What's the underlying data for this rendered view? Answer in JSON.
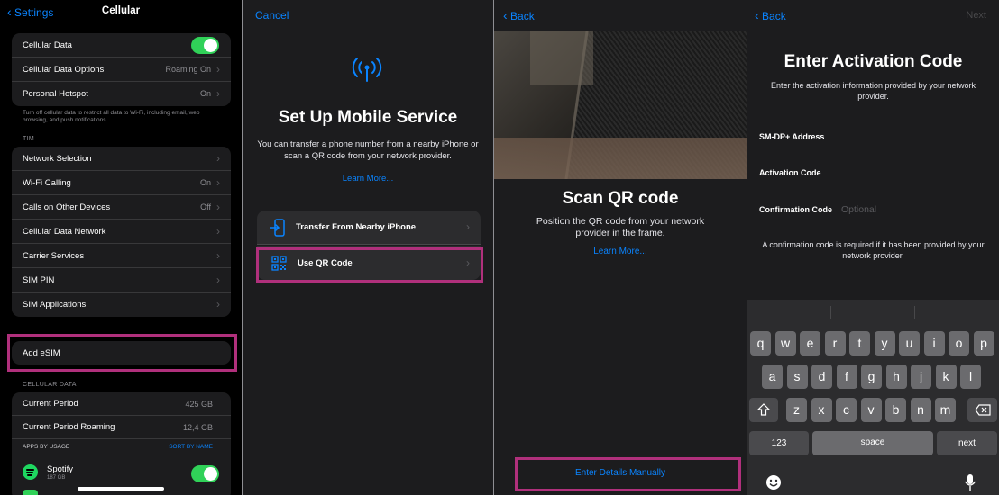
{
  "panel1": {
    "back_label": "Settings",
    "title": "Cellular",
    "top_rows": [
      {
        "label": "Cellular Data",
        "value": ""
      },
      {
        "label": "Cellular Data Options",
        "value": "Roaming On"
      },
      {
        "label": "Personal Hotspot",
        "value": "On"
      }
    ],
    "footnote": "Turn off cellular data to restrict all data to Wi-Fi, including email, web browsing, and push notifications.",
    "carrier_header": "TIM",
    "carrier_rows": [
      {
        "label": "Network Selection",
        "value": ""
      },
      {
        "label": "Wi-Fi Calling",
        "value": "On"
      },
      {
        "label": "Calls on Other Devices",
        "value": "Off"
      },
      {
        "label": "Cellular Data Network",
        "value": ""
      },
      {
        "label": "Carrier Services",
        "value": ""
      },
      {
        "label": "SIM PIN",
        "value": ""
      },
      {
        "label": "SIM Applications",
        "value": ""
      }
    ],
    "add_esim": "Add eSIM",
    "data_header": "CELLULAR DATA",
    "usage_rows": [
      {
        "label": "Current Period",
        "value": "425 GB"
      },
      {
        "label": "Current Period Roaming",
        "value": "12,4 GB"
      }
    ],
    "apps_header": "APPS BY USAGE",
    "sort_label": "SORT BY NAME",
    "app": {
      "name": "Spotify",
      "size": "187 GB"
    }
  },
  "panel2": {
    "cancel": "Cancel",
    "title": "Set Up Mobile Service",
    "subtitle": "You can transfer a phone number from a nearby iPhone or scan a QR code from your network provider.",
    "learn_more": "Learn More...",
    "options": [
      {
        "label": "Transfer From Nearby iPhone",
        "icon": "phone-transfer-icon"
      },
      {
        "label": "Use QR Code",
        "icon": "qr-code-icon"
      }
    ]
  },
  "panel3": {
    "back": "Back",
    "title": "Scan QR code",
    "subtitle": "Position the QR code from your network provider in the frame.",
    "learn_more": "Learn More...",
    "manual": "Enter Details Manually"
  },
  "panel4": {
    "back": "Back",
    "next": "Next",
    "title": "Enter Activation Code",
    "subtitle": "Enter the activation information provided by your network provider.",
    "fields": [
      {
        "label": "SM-DP+ Address",
        "placeholder": ""
      },
      {
        "label": "Activation Code",
        "placeholder": ""
      },
      {
        "label": "Confirmation Code",
        "placeholder": "Optional"
      }
    ],
    "note": "A confirmation code is required if it has been provided by your network provider.",
    "keyboard": {
      "row1": [
        "q",
        "w",
        "e",
        "r",
        "t",
        "y",
        "u",
        "i",
        "o",
        "p"
      ],
      "row2": [
        "a",
        "s",
        "d",
        "f",
        "g",
        "h",
        "j",
        "k",
        "l"
      ],
      "row3": [
        "z",
        "x",
        "c",
        "v",
        "b",
        "n",
        "m"
      ],
      "numbers": "123",
      "space": "space",
      "next": "next"
    }
  },
  "colors": {
    "accent": "#0a84ff",
    "toggle_on": "#30d158",
    "highlight": "#b0307c"
  }
}
